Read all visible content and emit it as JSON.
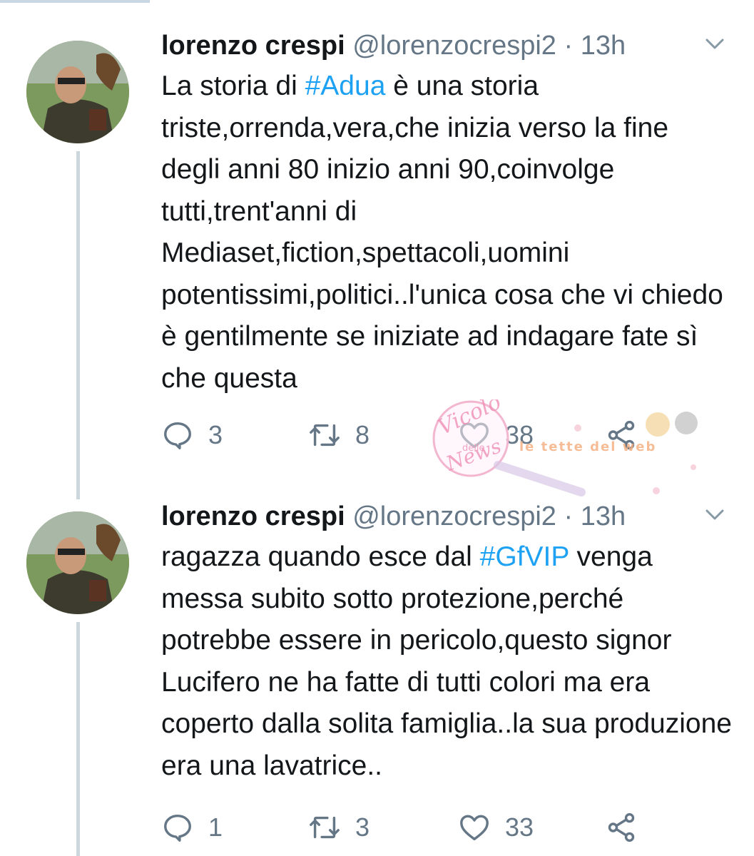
{
  "colors": {
    "link": "#1da1f2",
    "secondary": "#657786",
    "text": "#14171a"
  },
  "tweets": [
    {
      "name": "lorenzo crespi",
      "handle": "@lorenzocrespi2",
      "dot": "·",
      "time": "13h",
      "text_before": "La storia di ",
      "hashtag": "#Adua",
      "text_after": " è una storia triste,orrenda,vera,che inizia verso la fine degli anni 80 inizio anni 90,coinvolge tutti,trent'anni di Mediaset,fiction,spettacoli,uomini potentissimi,politici..l'unica cosa che vi chiedo è gentilmente se iniziate ad indagare fate sì che questa",
      "replies": "3",
      "retweets": "8",
      "likes": "38"
    },
    {
      "name": "lorenzo crespi",
      "handle": "@lorenzocrespi2",
      "dot": "·",
      "time": "13h",
      "text_before": "ragazza quando esce dal ",
      "hashtag": "#GfVIP",
      "text_after": " venga messa subito sotto protezione,perché potrebbe essere in pericolo,questo signor Lucifero ne ha fatte di tutti colori ma era coperto dalla solita famiglia..la sua produzione era una lavatrice..",
      "replies": "1",
      "retweets": "3",
      "likes": "33"
    }
  ],
  "watermark": {
    "logo_text_1": "Vicolo",
    "logo_text_2": "delle",
    "logo_text_3": "News",
    "brand_text": "le tette del web"
  },
  "icons": [
    "chevron-down-icon",
    "reply-icon",
    "retweet-icon",
    "like-icon",
    "share-icon"
  ]
}
